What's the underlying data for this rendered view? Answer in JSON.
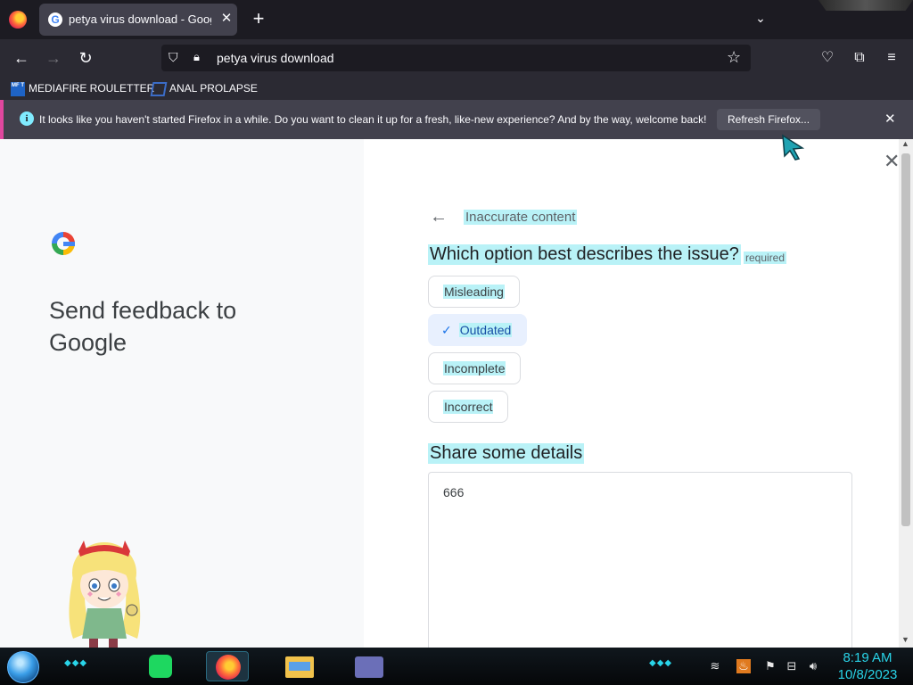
{
  "browser": {
    "tab": {
      "title": "petya virus download - Google",
      "favicon": "G"
    },
    "url": "petya virus download",
    "bookmarks": [
      {
        "icon_text": "MF T",
        "label": "MEDIAFIRE ROULETTER"
      },
      {
        "label": "ANAL PROLAPSE"
      }
    ],
    "notification": {
      "message": "It looks like you haven't started Firefox in a while. Do you want to clean it up for a fresh, like-new experience? And by the way, welcome back!",
      "button": "Refresh Firefox...",
      "info_glyph": "i"
    }
  },
  "feedback": {
    "heading": "Send feedback to Google",
    "breadcrumb": "Inaccurate content",
    "question": "Which option best describes the issue?",
    "required": "required",
    "options": [
      {
        "label": "Misleading",
        "selected": false
      },
      {
        "label": "Outdated",
        "selected": true
      },
      {
        "label": "Incomplete",
        "selected": false
      },
      {
        "label": "Incorrect",
        "selected": false
      }
    ],
    "details_label": "Share some details",
    "details_value": "666"
  },
  "taskbar": {
    "time": "8:19 AM",
    "date": "10/8/2023"
  },
  "colors": {
    "highlight": "#b9f2f7",
    "selected_bg": "#e8f0fe",
    "firefox_dark": "#1c1b22",
    "clock": "#29d4e8"
  }
}
